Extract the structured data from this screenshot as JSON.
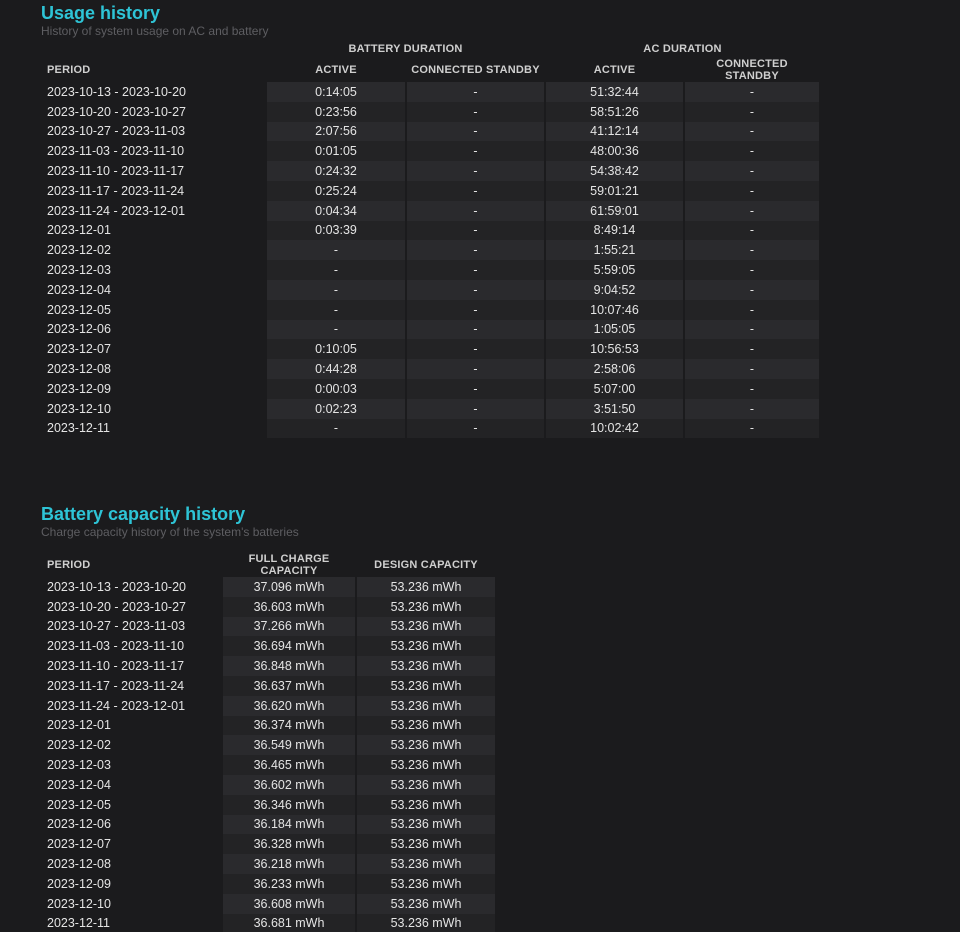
{
  "usage": {
    "title": "Usage history",
    "subtitle": "History of system usage on AC and battery",
    "group_battery": "BATTERY DURATION",
    "group_ac": "AC DURATION",
    "columns": [
      "PERIOD",
      "ACTIVE",
      "CONNECTED STANDBY",
      "ACTIVE",
      "CONNECTED STANDBY"
    ],
    "rows": [
      {
        "period": "2023-10-13 - 2023-10-20",
        "bat_active": "0:14:05",
        "bat_standby": "-",
        "ac_active": "51:32:44",
        "ac_standby": "-"
      },
      {
        "period": "2023-10-20 - 2023-10-27",
        "bat_active": "0:23:56",
        "bat_standby": "-",
        "ac_active": "58:51:26",
        "ac_standby": "-"
      },
      {
        "period": "2023-10-27 - 2023-11-03",
        "bat_active": "2:07:56",
        "bat_standby": "-",
        "ac_active": "41:12:14",
        "ac_standby": "-"
      },
      {
        "period": "2023-11-03 - 2023-11-10",
        "bat_active": "0:01:05",
        "bat_standby": "-",
        "ac_active": "48:00:36",
        "ac_standby": "-"
      },
      {
        "period": "2023-11-10 - 2023-11-17",
        "bat_active": "0:24:32",
        "bat_standby": "-",
        "ac_active": "54:38:42",
        "ac_standby": "-"
      },
      {
        "period": "2023-11-17 - 2023-11-24",
        "bat_active": "0:25:24",
        "bat_standby": "-",
        "ac_active": "59:01:21",
        "ac_standby": "-"
      },
      {
        "period": "2023-11-24 - 2023-12-01",
        "bat_active": "0:04:34",
        "bat_standby": "-",
        "ac_active": "61:59:01",
        "ac_standby": "-"
      },
      {
        "period": "2023-12-01",
        "bat_active": "0:03:39",
        "bat_standby": "-",
        "ac_active": "8:49:14",
        "ac_standby": "-"
      },
      {
        "period": "2023-12-02",
        "bat_active": "-",
        "bat_standby": "-",
        "ac_active": "1:55:21",
        "ac_standby": "-"
      },
      {
        "period": "2023-12-03",
        "bat_active": "-",
        "bat_standby": "-",
        "ac_active": "5:59:05",
        "ac_standby": "-"
      },
      {
        "period": "2023-12-04",
        "bat_active": "-",
        "bat_standby": "-",
        "ac_active": "9:04:52",
        "ac_standby": "-"
      },
      {
        "period": "2023-12-05",
        "bat_active": "-",
        "bat_standby": "-",
        "ac_active": "10:07:46",
        "ac_standby": "-"
      },
      {
        "period": "2023-12-06",
        "bat_active": "-",
        "bat_standby": "-",
        "ac_active": "1:05:05",
        "ac_standby": "-"
      },
      {
        "period": "2023-12-07",
        "bat_active": "0:10:05",
        "bat_standby": "-",
        "ac_active": "10:56:53",
        "ac_standby": "-"
      },
      {
        "period": "2023-12-08",
        "bat_active": "0:44:28",
        "bat_standby": "-",
        "ac_active": "2:58:06",
        "ac_standby": "-"
      },
      {
        "period": "2023-12-09",
        "bat_active": "0:00:03",
        "bat_standby": "-",
        "ac_active": "5:07:00",
        "ac_standby": "-"
      },
      {
        "period": "2023-12-10",
        "bat_active": "0:02:23",
        "bat_standby": "-",
        "ac_active": "3:51:50",
        "ac_standby": "-"
      },
      {
        "period": "2023-12-11",
        "bat_active": "-",
        "bat_standby": "-",
        "ac_active": "10:02:42",
        "ac_standby": "-"
      }
    ]
  },
  "capacity": {
    "title": "Battery capacity history",
    "subtitle": "Charge capacity history of the system's batteries",
    "columns": [
      "PERIOD",
      "FULL CHARGE CAPACITY",
      "DESIGN CAPACITY"
    ],
    "rows": [
      {
        "period": "2023-10-13 - 2023-10-20",
        "full": "37.096 mWh",
        "design": "53.236 mWh"
      },
      {
        "period": "2023-10-20 - 2023-10-27",
        "full": "36.603 mWh",
        "design": "53.236 mWh"
      },
      {
        "period": "2023-10-27 - 2023-11-03",
        "full": "37.266 mWh",
        "design": "53.236 mWh"
      },
      {
        "period": "2023-11-03 - 2023-11-10",
        "full": "36.694 mWh",
        "design": "53.236 mWh"
      },
      {
        "period": "2023-11-10 - 2023-11-17",
        "full": "36.848 mWh",
        "design": "53.236 mWh"
      },
      {
        "period": "2023-11-17 - 2023-11-24",
        "full": "36.637 mWh",
        "design": "53.236 mWh"
      },
      {
        "period": "2023-11-24 - 2023-12-01",
        "full": "36.620 mWh",
        "design": "53.236 mWh"
      },
      {
        "period": "2023-12-01",
        "full": "36.374 mWh",
        "design": "53.236 mWh"
      },
      {
        "period": "2023-12-02",
        "full": "36.549 mWh",
        "design": "53.236 mWh"
      },
      {
        "period": "2023-12-03",
        "full": "36.465 mWh",
        "design": "53.236 mWh"
      },
      {
        "period": "2023-12-04",
        "full": "36.602 mWh",
        "design": "53.236 mWh"
      },
      {
        "period": "2023-12-05",
        "full": "36.346 mWh",
        "design": "53.236 mWh"
      },
      {
        "period": "2023-12-06",
        "full": "36.184 mWh",
        "design": "53.236 mWh"
      },
      {
        "period": "2023-12-07",
        "full": "36.328 mWh",
        "design": "53.236 mWh"
      },
      {
        "period": "2023-12-08",
        "full": "36.218 mWh",
        "design": "53.236 mWh"
      },
      {
        "period": "2023-12-09",
        "full": "36.233 mWh",
        "design": "53.236 mWh"
      },
      {
        "period": "2023-12-10",
        "full": "36.608 mWh",
        "design": "53.236 mWh"
      },
      {
        "period": "2023-12-11",
        "full": "36.681 mWh",
        "design": "53.236 mWh"
      }
    ]
  }
}
